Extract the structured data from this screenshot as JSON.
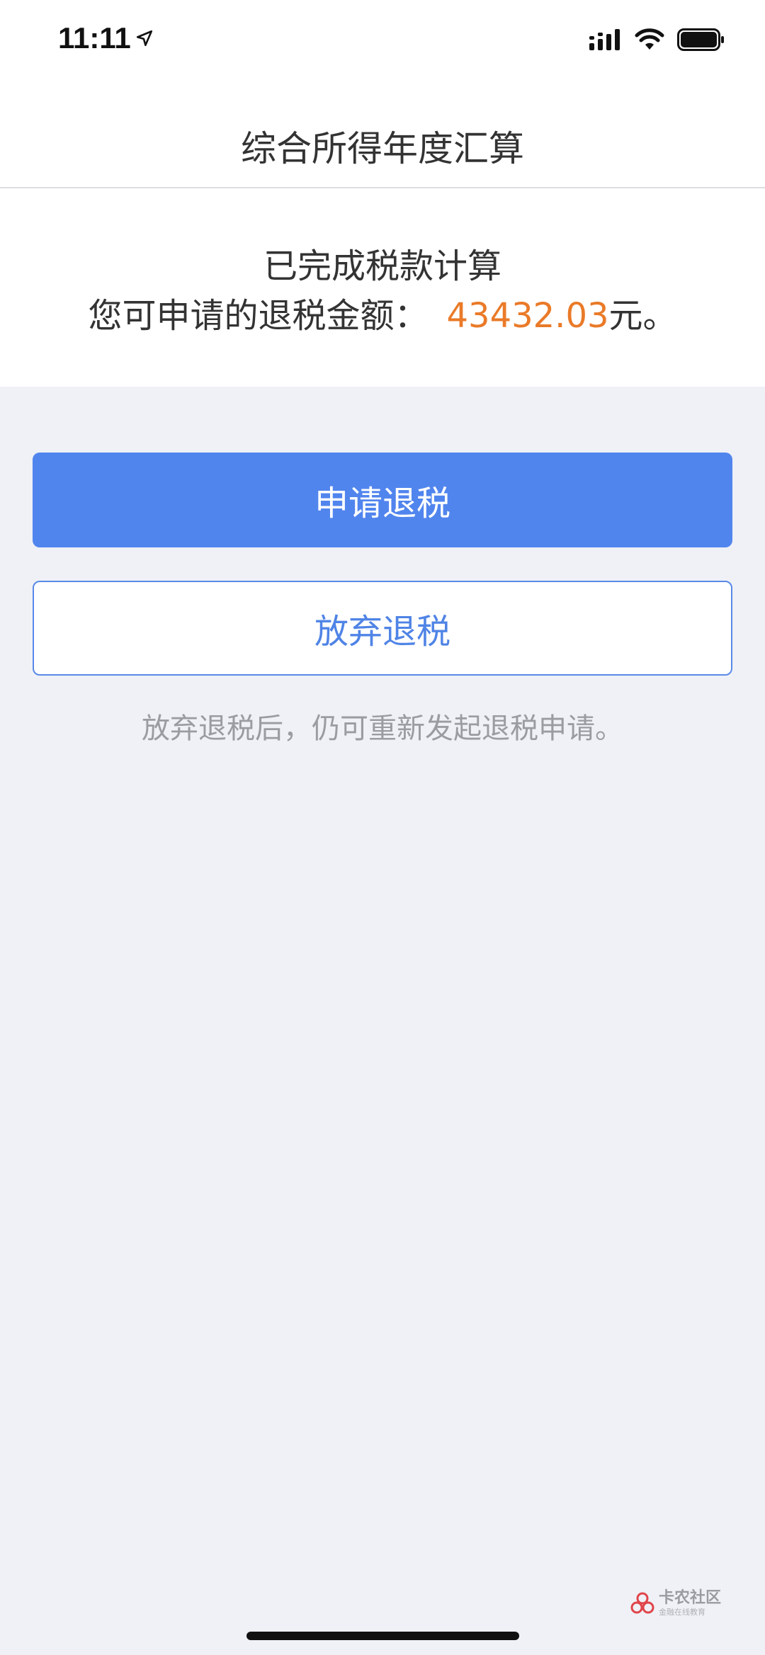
{
  "status_bar": {
    "time": "11:11"
  },
  "nav": {
    "title": "综合所得年度汇算"
  },
  "result": {
    "status_text": "已完成税款计算",
    "amount_label": "您可申请的退税金额：",
    "amount": "43432.03",
    "amount_suffix": "元。",
    "amount_color": "#ea7a28"
  },
  "actions": {
    "apply_label": "申请退税",
    "abandon_label": "放弃退税",
    "hint": "放弃退税后，仍可重新发起退税申请。",
    "primary_color": "#5185ee"
  },
  "watermark": {
    "title": "卡农社区",
    "subtitle": "金融在线教育"
  },
  "icons": [
    "location-arrow-icon",
    "cellular-signal-icon",
    "wifi-icon",
    "battery-icon",
    "kanong-logo-icon"
  ]
}
